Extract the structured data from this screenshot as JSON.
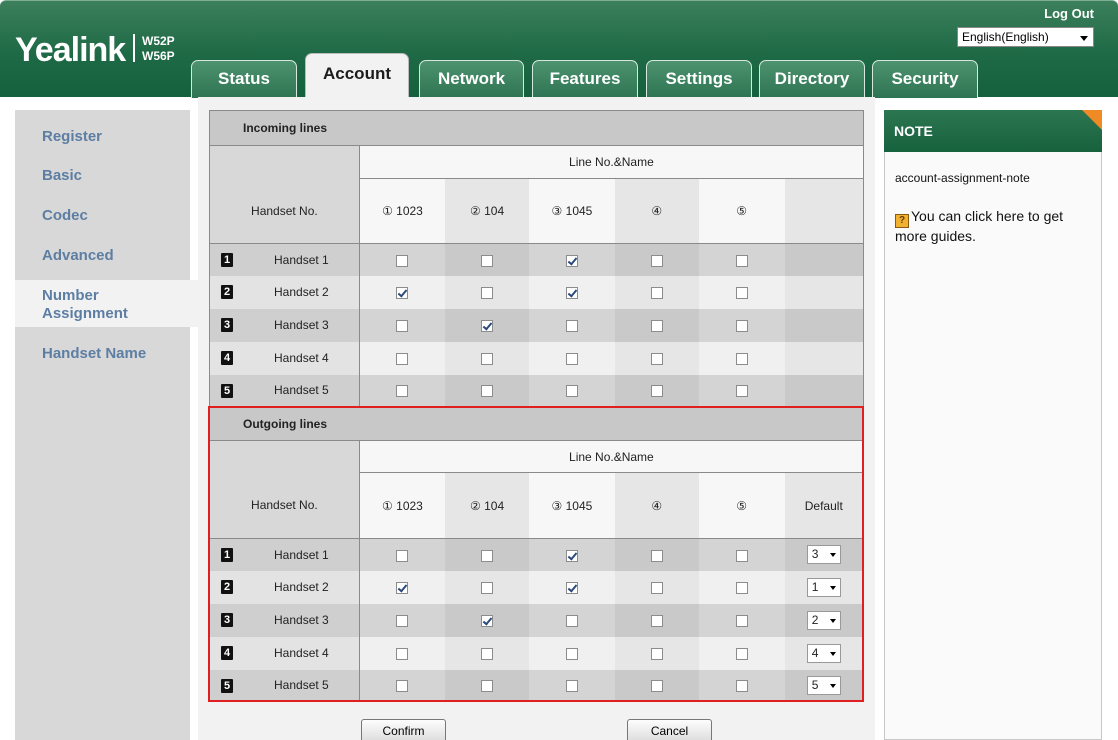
{
  "header": {
    "logo": "Yealink",
    "models": [
      "W52P",
      "W56P"
    ],
    "logout": "Log Out",
    "language": "English(English)"
  },
  "tabs": [
    {
      "label": "Status"
    },
    {
      "label": "Account",
      "active": true
    },
    {
      "label": "Network"
    },
    {
      "label": "Features"
    },
    {
      "label": "Settings"
    },
    {
      "label": "Directory"
    },
    {
      "label": "Security"
    }
  ],
  "sidebar": {
    "items": [
      {
        "label": "Register"
      },
      {
        "label": "Basic"
      },
      {
        "label": "Codec"
      },
      {
        "label": "Advanced"
      },
      {
        "label": "Number Assignment",
        "active": true
      },
      {
        "label": "Handset Name"
      }
    ]
  },
  "incoming": {
    "title": "Incoming lines",
    "line_header": "Line No.&Name",
    "handset_header": "Handset No.",
    "lines": [
      "① 1023",
      "② 104",
      "③ 1045",
      "④",
      "⑤"
    ],
    "rows": [
      {
        "num": "1",
        "name": "Handset 1",
        "checks": [
          false,
          false,
          true,
          false,
          false
        ]
      },
      {
        "num": "2",
        "name": "Handset 2",
        "checks": [
          true,
          false,
          true,
          false,
          false
        ]
      },
      {
        "num": "3",
        "name": "Handset 3",
        "checks": [
          false,
          true,
          false,
          false,
          false
        ]
      },
      {
        "num": "4",
        "name": "Handset 4",
        "checks": [
          false,
          false,
          false,
          false,
          false
        ]
      },
      {
        "num": "5",
        "name": "Handset 5",
        "checks": [
          false,
          false,
          false,
          false,
          false
        ]
      }
    ]
  },
  "outgoing": {
    "title": "Outgoing lines",
    "line_header": "Line No.&Name",
    "handset_header": "Handset No.",
    "default_header": "Default",
    "lines": [
      "① 1023",
      "② 104",
      "③ 1045",
      "④",
      "⑤"
    ],
    "rows": [
      {
        "num": "1",
        "name": "Handset 1",
        "checks": [
          false,
          false,
          true,
          false,
          false
        ],
        "default": "3"
      },
      {
        "num": "2",
        "name": "Handset 2",
        "checks": [
          true,
          false,
          true,
          false,
          false
        ],
        "default": "1"
      },
      {
        "num": "3",
        "name": "Handset 3",
        "checks": [
          false,
          true,
          false,
          false,
          false
        ],
        "default": "2"
      },
      {
        "num": "4",
        "name": "Handset 4",
        "checks": [
          false,
          false,
          false,
          false,
          false
        ],
        "default": "4"
      },
      {
        "num": "5",
        "name": "Handset 5",
        "checks": [
          false,
          false,
          false,
          false,
          false
        ],
        "default": "5"
      }
    ]
  },
  "buttons": {
    "confirm": "Confirm",
    "cancel": "Cancel"
  },
  "note": {
    "title": "NOTE",
    "heading": "account-assignment-note",
    "help_icon": "?",
    "text": "You can click here to get more guides."
  },
  "colors": {
    "brand_green": "#1f6a46",
    "highlight_red": "#e02020",
    "link_blue": "#5d7ea3",
    "note_corner": "#f08a24"
  }
}
